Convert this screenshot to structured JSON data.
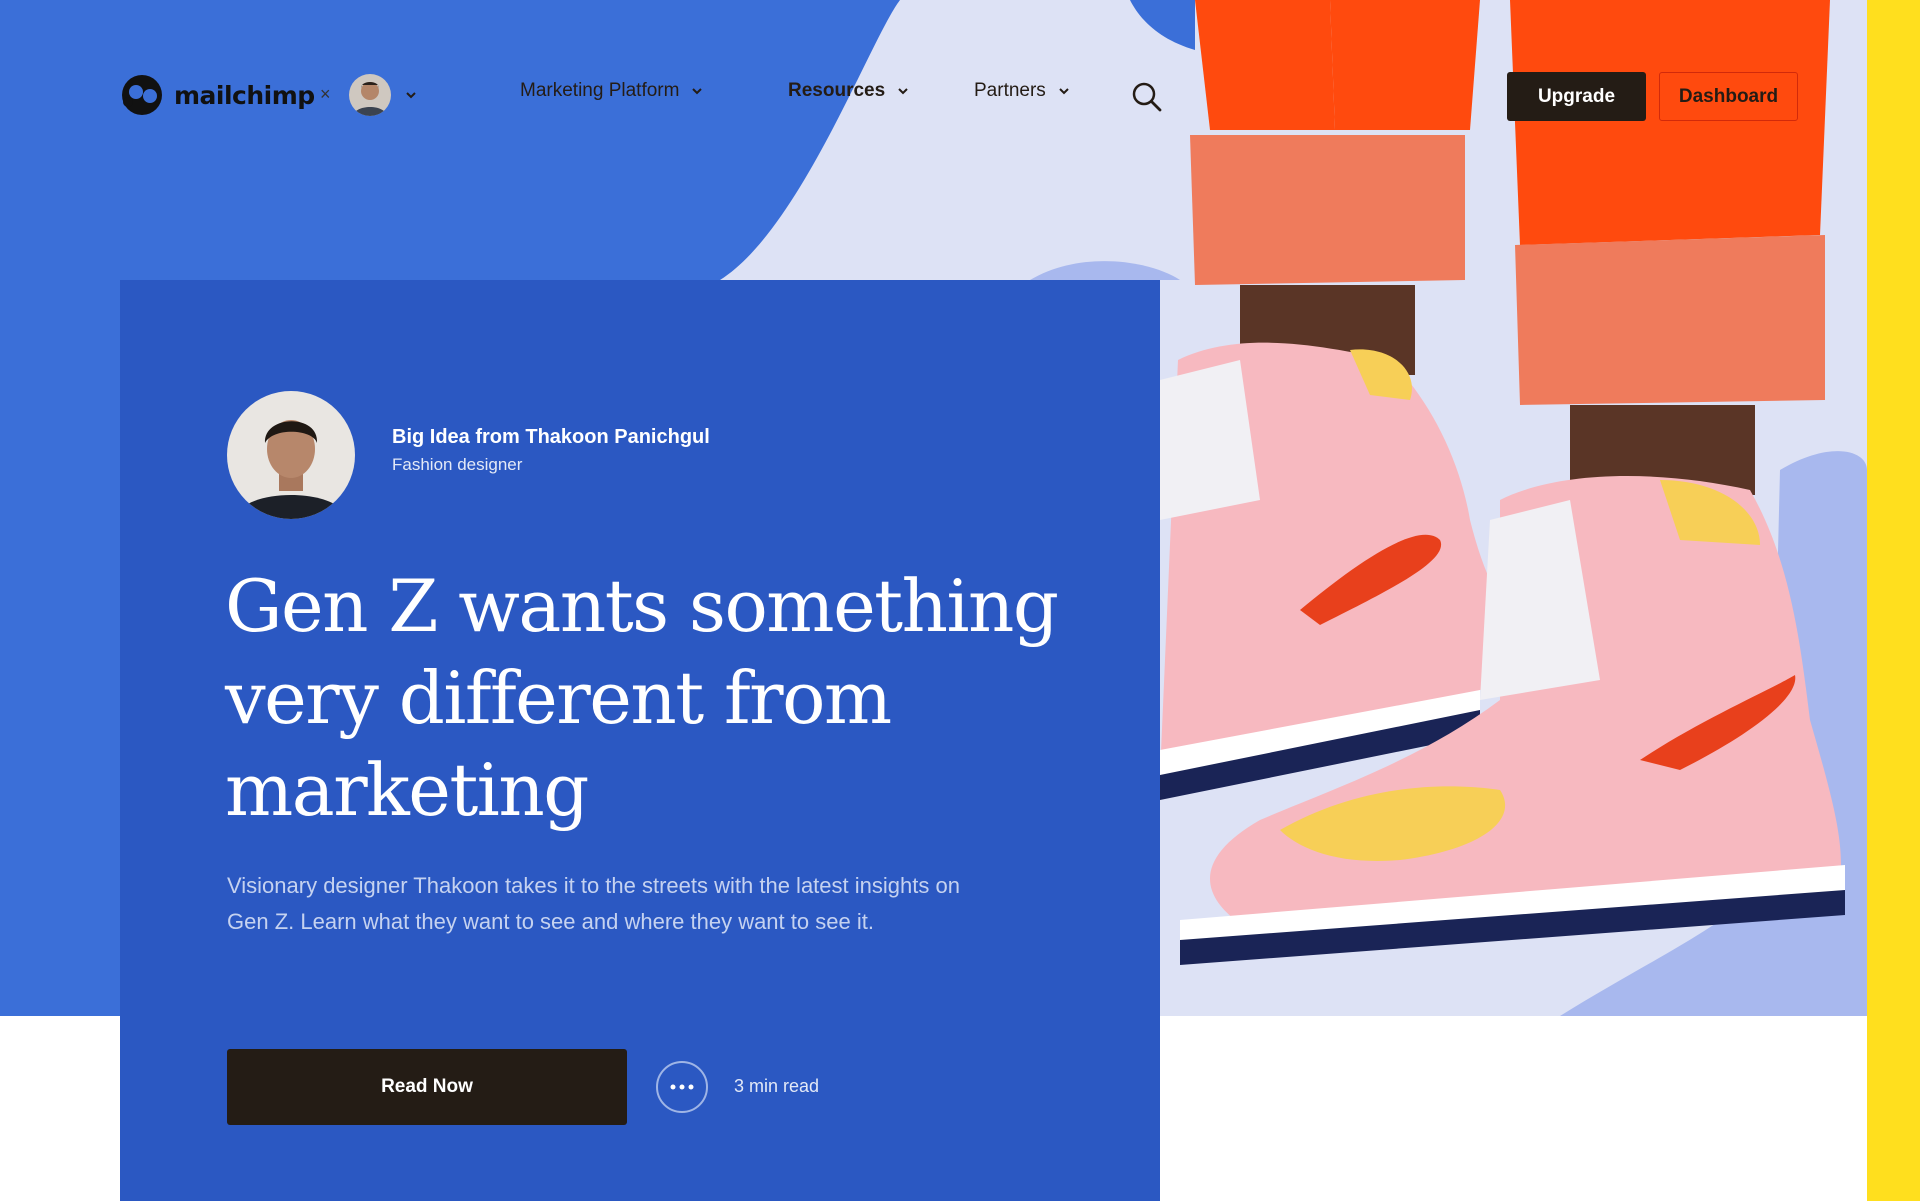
{
  "brand": {
    "logo_text": "mailchimp",
    "separator": "×"
  },
  "nav": {
    "items": [
      {
        "label": "Marketing Platform"
      },
      {
        "label": "Resources"
      },
      {
        "label": "Partners"
      }
    ]
  },
  "header_actions": {
    "upgrade_label": "Upgrade",
    "dashboard_label": "Dashboard"
  },
  "hero": {
    "author_name": "Big Idea from Thakoon Panichgul",
    "author_role": "Fashion designer",
    "headline": "Gen Z wants something very different from marketing",
    "summary": "Visionary designer Thakoon takes it to the streets with the latest insights on Gen Z. Learn what they want to see and where they want to see it.",
    "cta_label": "Read Now",
    "read_time": "3 min read"
  },
  "icons": {
    "logo": "chimp-logo-icon",
    "chevron": "chevron-down-icon",
    "search": "search-icon",
    "more": "more-options-icon"
  },
  "colors": {
    "hero_blue": "#3b6fd8",
    "card_blue": "#2b58c2",
    "dark_button": "#241c15",
    "dashboard_border": "#d22a0a",
    "side_yellow": "#ffdf1e",
    "sneaker_swoosh": "#e8401c"
  }
}
